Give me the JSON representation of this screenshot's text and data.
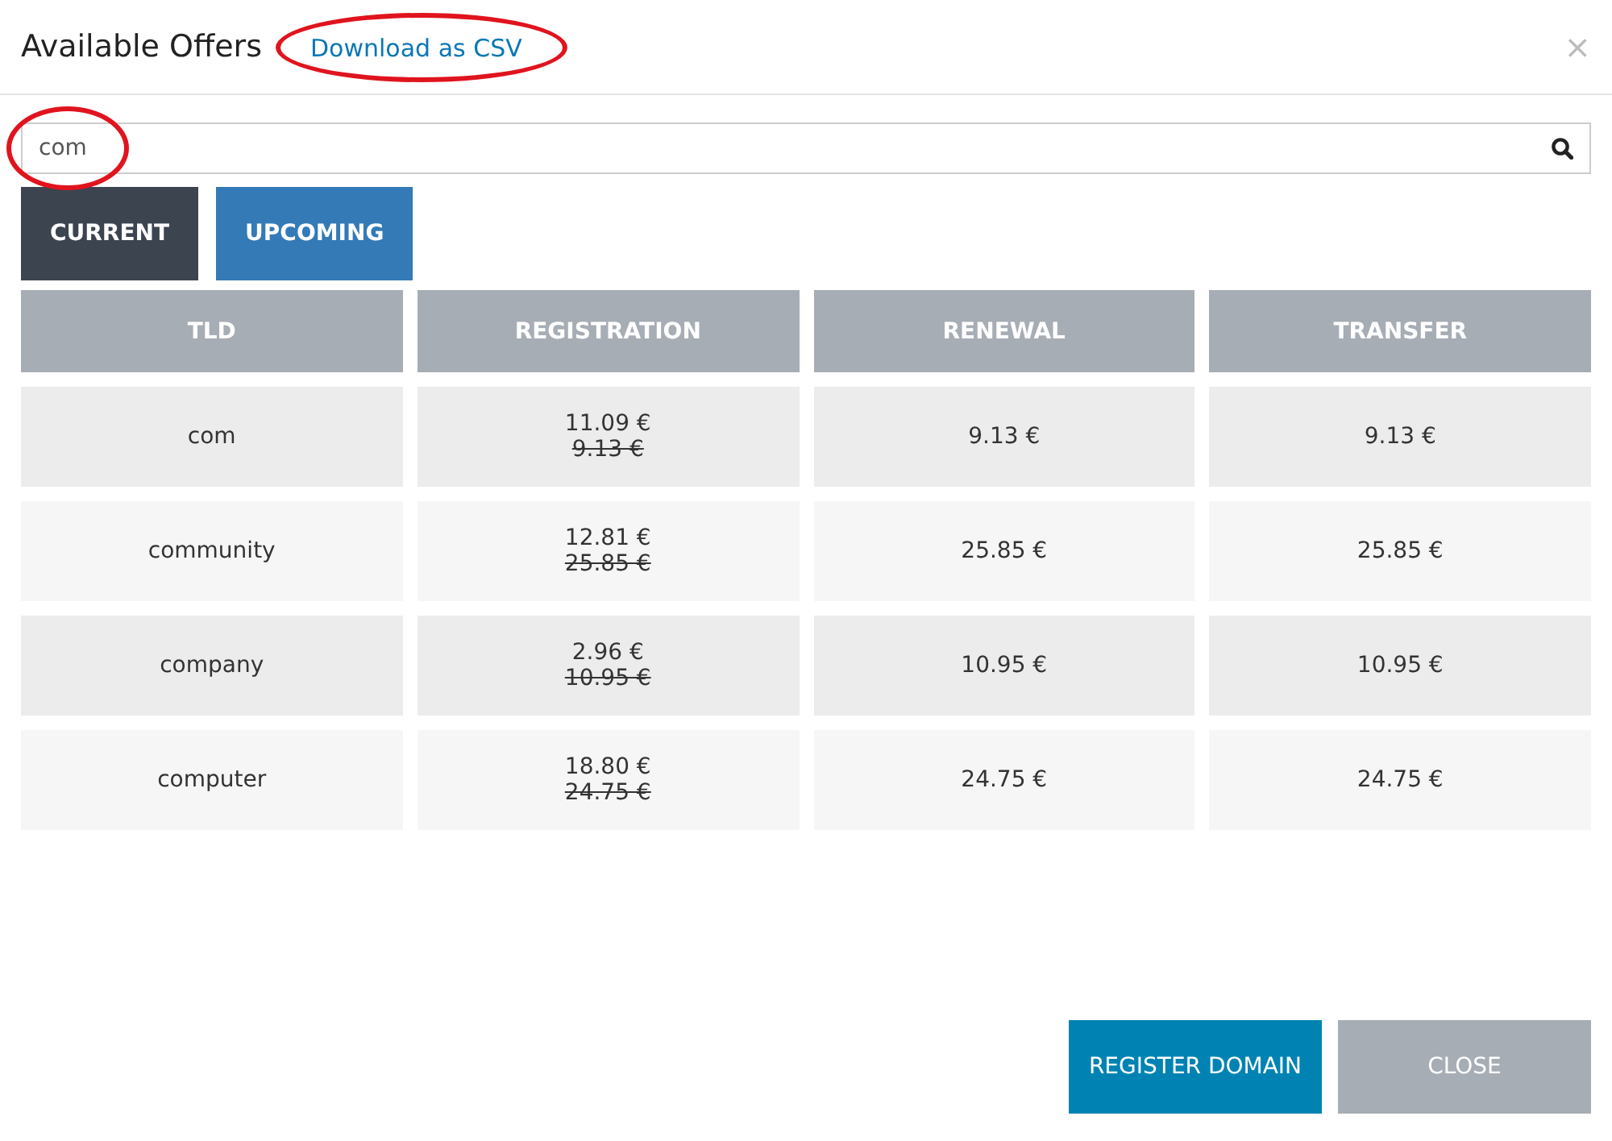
{
  "dialog": {
    "title": "Available Offers",
    "close_icon": "×"
  },
  "download_link": {
    "label": "Download as CSV",
    "highlighted": true
  },
  "search": {
    "value": "com",
    "highlighted": true
  },
  "tabs": [
    {
      "label": "CURRENT",
      "selected": true
    },
    {
      "label": "UPCOMING",
      "selected": false
    }
  ],
  "table": {
    "columns": [
      "TLD",
      "REGISTRATION",
      "RENEWAL",
      "TRANSFER"
    ],
    "rows": [
      {
        "tld": "com",
        "registration": "11.09 €",
        "registration_old": "9.13 €",
        "renewal": "9.13 €",
        "transfer": "9.13 €"
      },
      {
        "tld": "community",
        "registration": "12.81 €",
        "registration_old": "25.85 €",
        "renewal": "25.85 €",
        "transfer": "25.85 €"
      },
      {
        "tld": "company",
        "registration": "2.96 €",
        "registration_old": "10.95 €",
        "renewal": "10.95 €",
        "transfer": "10.95 €"
      },
      {
        "tld": "computer",
        "registration": "18.80 €",
        "registration_old": "24.75 €",
        "renewal": "24.75 €",
        "transfer": "24.75 €"
      }
    ]
  },
  "buttons": [
    {
      "label": "REGISTER DOMAIN",
      "kind": "primary"
    },
    {
      "label": "CLOSE",
      "kind": "secondary"
    }
  ]
}
